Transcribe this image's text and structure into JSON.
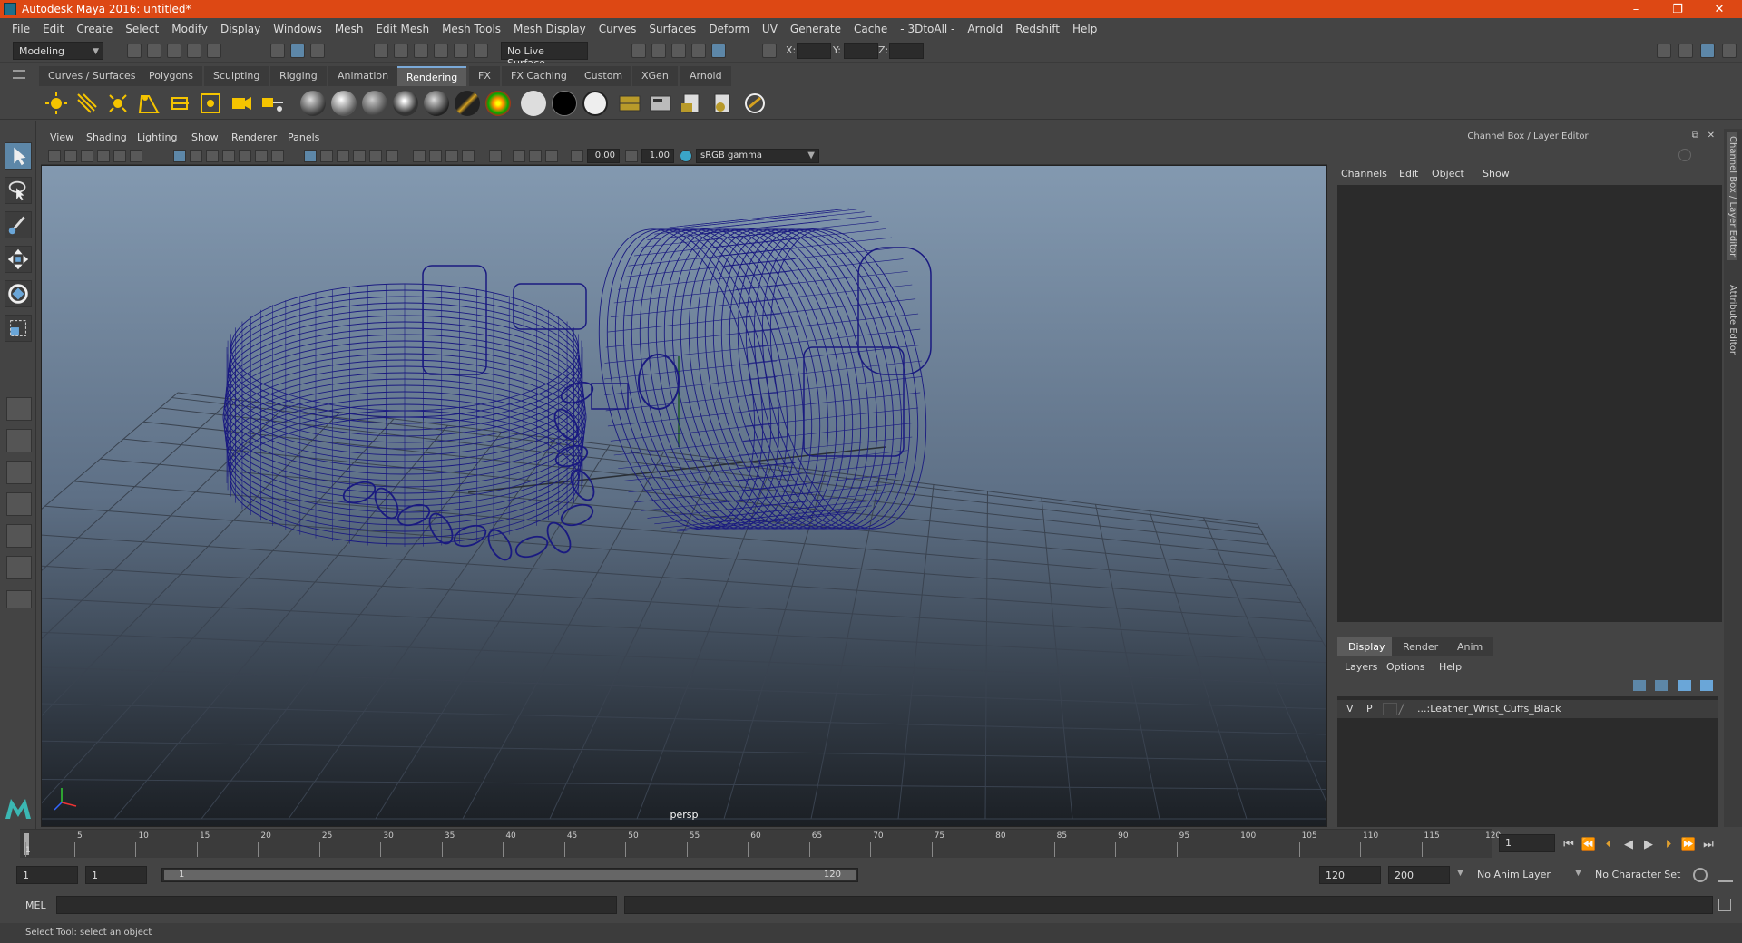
{
  "window": {
    "title": "Autodesk Maya 2016: untitled*",
    "controls": {
      "minimize": "–",
      "restore": "❐",
      "close": "✕"
    }
  },
  "menubar": [
    "File",
    "Edit",
    "Create",
    "Select",
    "Modify",
    "Display",
    "Windows",
    "Mesh",
    "Edit Mesh",
    "Mesh Tools",
    "Mesh Display",
    "Curves",
    "Surfaces",
    "Deform",
    "UV",
    "Generate",
    "Cache",
    "- 3DtoAll -",
    "Arnold",
    "Redshift",
    "Help"
  ],
  "statusline": {
    "menuset": "Modeling",
    "live_surface": "No Live Surface",
    "x_label": "X:",
    "y_label": "Y:",
    "z_label": "Z:"
  },
  "shelf": {
    "tabs": [
      "Curves / Surfaces",
      "Polygons",
      "Sculpting",
      "Rigging",
      "Animation",
      "Rendering",
      "FX",
      "FX Caching",
      "Custom",
      "XGen",
      "Arnold"
    ],
    "active_tab": "Rendering"
  },
  "viewport": {
    "menus": [
      "View",
      "Shading",
      "Lighting",
      "Show",
      "Renderer",
      "Panels"
    ],
    "exposure": "0.00",
    "gamma": "1.00",
    "color_space": "sRGB gamma",
    "camera": "persp",
    "wire_color": "#1a1a80"
  },
  "right_panel": {
    "title": "Channel Box / Layer Editor",
    "menus": [
      "Channels",
      "Edit",
      "Object",
      "Show"
    ],
    "layer_tabs": [
      "Display",
      "Render",
      "Anim"
    ],
    "active_layer_tab": "Display",
    "layer_menus": [
      "Layers",
      "Options",
      "Help"
    ],
    "layers": [
      {
        "visible": "V",
        "playback": "P",
        "name": "...:Leather_Wrist_Cuffs_Black"
      }
    ],
    "side_tabs": [
      "Channel Box / Layer Editor",
      "Attribute Editor"
    ]
  },
  "timeslider": {
    "ticks": [
      "1",
      "5",
      "10",
      "15",
      "20",
      "25",
      "30",
      "35",
      "40",
      "45",
      "50",
      "55",
      "60",
      "65",
      "70",
      "75",
      "80",
      "85",
      "90",
      "95",
      "100",
      "105",
      "110",
      "115",
      "120"
    ],
    "current_frame": "1"
  },
  "range": {
    "start": "1",
    "playback_start": "1",
    "slider_start": "1",
    "slider_end": "120",
    "playback_end": "120",
    "end": "200",
    "anim_layer": "No Anim Layer",
    "character_set": "No Character Set"
  },
  "commandline": {
    "label": "MEL"
  },
  "helpline": {
    "text": "Select Tool: select an object"
  }
}
